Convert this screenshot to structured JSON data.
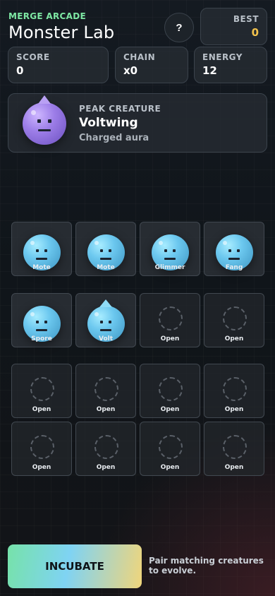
{
  "header": {
    "kicker": "MERGE ARCADE",
    "title": "Monster Lab",
    "help_label": "?"
  },
  "best": {
    "label": "BEST",
    "value": "0"
  },
  "stats": {
    "score": {
      "label": "SCORE",
      "value": "0"
    },
    "chain": {
      "label": "CHAIN",
      "value": "x0"
    },
    "energy": {
      "label": "ENERGY",
      "value": "12"
    }
  },
  "peak": {
    "label": "PEAK CREATURE",
    "name": "Voltwing",
    "subtitle": "Charged aura",
    "icon": "purple-spiked-creature"
  },
  "board": {
    "tiles": [
      {
        "label": "Mote",
        "creature": "blue-blob"
      },
      {
        "label": "Mote",
        "creature": "blue-blob"
      },
      {
        "label": "Glimmer",
        "creature": "blue-blob"
      },
      {
        "label": "Fang",
        "creature": "blue-blob"
      },
      {
        "label": "Spore",
        "creature": "blue-blob"
      },
      {
        "label": "Volt",
        "creature": "blue-spiked-blob"
      },
      {
        "label": "Open",
        "creature": "empty"
      },
      {
        "label": "Open",
        "creature": "empty"
      },
      {
        "label": "Open",
        "creature": "empty"
      },
      {
        "label": "Open",
        "creature": "empty"
      },
      {
        "label": "Open",
        "creature": "empty"
      },
      {
        "label": "Open",
        "creature": "empty"
      },
      {
        "label": "Open",
        "creature": "empty"
      },
      {
        "label": "Open",
        "creature": "empty"
      },
      {
        "label": "Open",
        "creature": "empty"
      },
      {
        "label": "Open",
        "creature": "empty"
      }
    ]
  },
  "actions": {
    "incubate_label": "INCUBATE",
    "hint": "Pair matching creatures to evolve."
  },
  "colors": {
    "accent_green": "#7ee8a4",
    "best_gold": "#f3c24c",
    "creature_blue": "#6cc8ef",
    "creature_purple": "#9d7ee8"
  }
}
